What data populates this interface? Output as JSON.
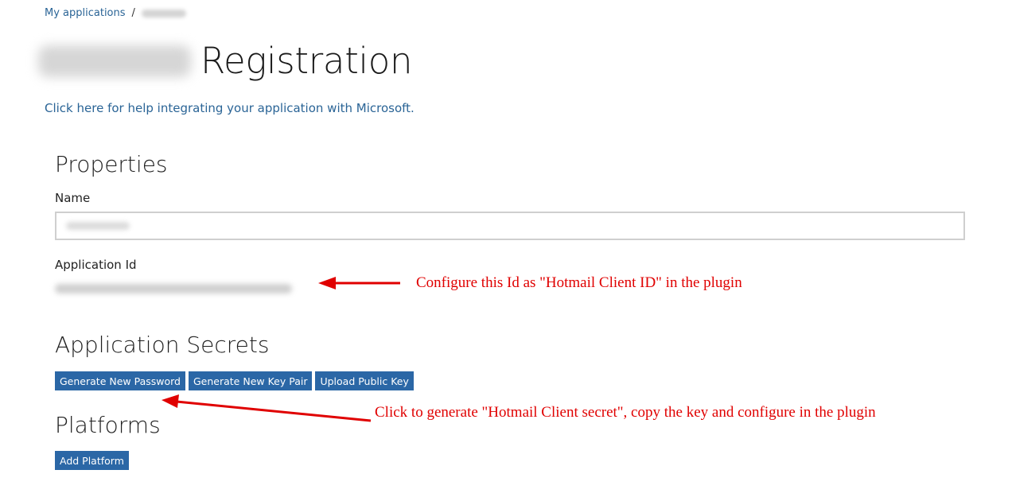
{
  "breadcrumb": {
    "root_label": "My applications",
    "separator": "/"
  },
  "header": {
    "title": "Registration",
    "help_link": "Click here for help integrating your application with Microsoft."
  },
  "properties": {
    "heading": "Properties",
    "name_label": "Name",
    "app_id_label": "Application Id"
  },
  "secrets": {
    "heading": "Application Secrets",
    "buttons": [
      "Generate New Password",
      "Generate New Key Pair",
      "Upload Public Key"
    ]
  },
  "platforms": {
    "heading": "Platforms",
    "add_button": "Add Platform"
  },
  "annotations": {
    "app_id_note": "Configure this Id as \"Hotmail Client ID\" in the plugin",
    "secret_note": "Click to generate \"Hotmail Client secret\", copy the key and configure in the plugin"
  },
  "colors": {
    "link": "#2a6496",
    "button": "#2b67a6",
    "annotation": "#e00000"
  }
}
